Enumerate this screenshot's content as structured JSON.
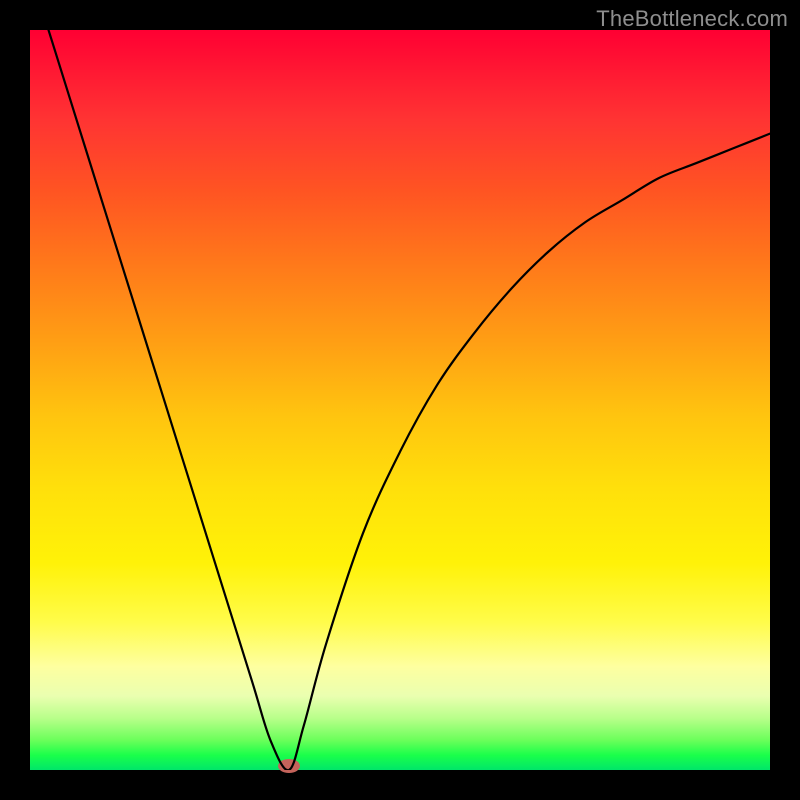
{
  "watermark": "TheBottleneck.com",
  "colors": {
    "page_bg": "#000000",
    "curve": "#000000",
    "marker": "#c4635b",
    "gradient_top": "#ff0033",
    "gradient_bottom": "#00e66a"
  },
  "chart_data": {
    "type": "line",
    "title": "",
    "xlabel": "",
    "ylabel": "",
    "xlim": [
      0,
      100
    ],
    "ylim": [
      0,
      100
    ],
    "grid": false,
    "legend": false,
    "annotations": [
      "TheBottleneck.com"
    ],
    "series": [
      {
        "name": "bottleneck-curve",
        "x": [
          0,
          5,
          10,
          15,
          20,
          25,
          30,
          32.5,
          35,
          37,
          40,
          45,
          50,
          55,
          60,
          65,
          70,
          75,
          80,
          85,
          90,
          95,
          100
        ],
        "values": [
          108,
          92,
          76,
          60,
          44,
          28,
          12,
          4,
          0,
          6,
          17,
          32,
          43,
          52,
          59,
          65,
          70,
          74,
          77,
          80,
          82,
          84,
          86
        ]
      }
    ],
    "marker": {
      "x": 35,
      "y": 0.5
    }
  }
}
